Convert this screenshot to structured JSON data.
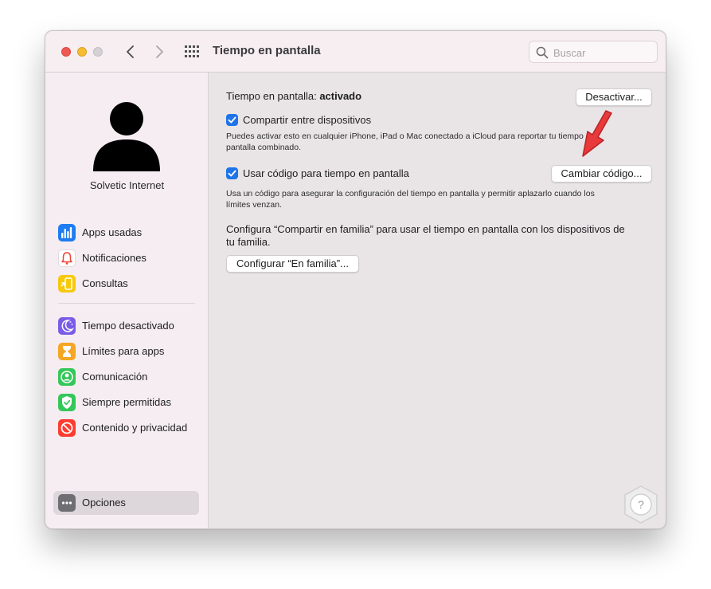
{
  "window": {
    "title": "Tiempo en pantalla",
    "search_placeholder": "Buscar"
  },
  "sidebar": {
    "user_name": "Solvetic Internet",
    "group1": [
      {
        "label": "Apps usadas",
        "icon": "bar-chart-icon",
        "color": "#1e7cf2"
      },
      {
        "label": "Notificaciones",
        "icon": "bell-icon",
        "color": "#ffffff"
      },
      {
        "label": "Consultas",
        "icon": "phone-pickup-icon",
        "color": "#f6c90e"
      }
    ],
    "group2": [
      {
        "label": "Tiempo desactivado",
        "icon": "downtime-icon",
        "color": "#7a5ce6"
      },
      {
        "label": "Límites para apps",
        "icon": "hourglass-icon",
        "color": "#f5a623"
      },
      {
        "label": "Comunicación",
        "icon": "contact-icon",
        "color": "#34c759"
      },
      {
        "label": "Siempre permitidas",
        "icon": "checkmark-shield-icon",
        "color": "#34c759"
      },
      {
        "label": "Contenido y privacidad",
        "icon": "no-entry-icon",
        "color": "#ff3b30"
      }
    ],
    "options_label": "Opciones"
  },
  "main": {
    "status_prefix": "Tiempo en pantalla: ",
    "status_value": "activado",
    "deactivate_button": "Desactivar...",
    "share_label": "Compartir entre dispositivos",
    "share_checked": true,
    "share_desc_line1": "Puedes activar esto en cualquier iPhone, iPad o Mac conectado a iCloud para reportar tu tiempo en",
    "share_desc_line2": "pantalla combinado.",
    "passcode_label": "Usar código para tiempo en pantalla",
    "passcode_checked": true,
    "change_code_button": "Cambiar código...",
    "passcode_desc_line1": "Usa un código para asegurar la configuración del tiempo en pantalla y permitir aplazarlo cuando los",
    "passcode_desc_line2": "límites venzan.",
    "family_desc_line1": "Configura “Compartir en familia” para usar el tiempo en pantalla con los dispositivos de",
    "family_desc_line2": "tu familia.",
    "family_button": "Configurar “En familia”..."
  },
  "colors": {
    "accent": "#1f74e9",
    "annotation_arrow": "#e8393b"
  }
}
